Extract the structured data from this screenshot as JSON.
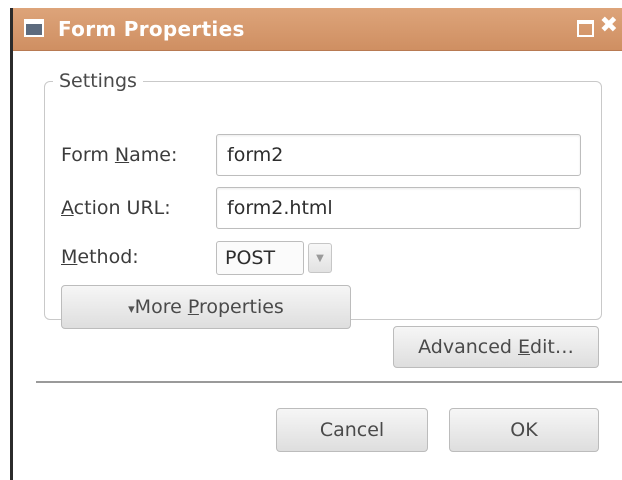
{
  "window": {
    "title": "Form Properties",
    "title_icon": "window-icon",
    "maximize_icon": "maximize-icon",
    "close_icon": "close-icon",
    "close_glyph": "✖"
  },
  "settings": {
    "legend": "Settings",
    "form_name": {
      "label_pre": "Form ",
      "label_mn": "N",
      "label_post": "ame:",
      "value": "form2"
    },
    "action_url": {
      "label_pre": "",
      "label_mn": "A",
      "label_post": "ction URL:",
      "value": "form2.html"
    },
    "method": {
      "label_pre": "",
      "label_mn": "M",
      "label_post": "ethod:",
      "value": "POST",
      "arrow": "▼"
    },
    "more_properties": {
      "bullet": "▾",
      "label_pre": "More ",
      "label_mn": "P",
      "label_post": "roperties"
    }
  },
  "advanced_edit": {
    "label_pre": "Advanced ",
    "label_mn": "E",
    "label_post": "dit…"
  },
  "footer": {
    "cancel_label": "Cancel",
    "ok_label": "OK"
  }
}
